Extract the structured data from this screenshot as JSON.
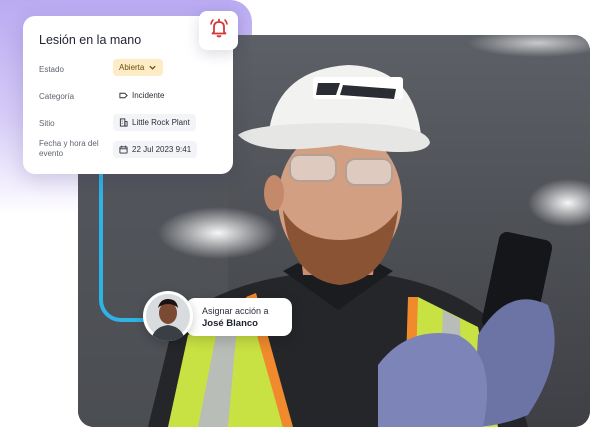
{
  "incident": {
    "title": "Lesión en la mano",
    "rows": {
      "status": {
        "label": "Estado",
        "value": "Abierta"
      },
      "category": {
        "label": "Categoría",
        "value": "Incidente"
      },
      "site": {
        "label": "Sitio",
        "value": "Little Rock Plant"
      },
      "datetime": {
        "label": "Fecha y hora del evento",
        "value": "22 Jul 2023 9:41"
      }
    }
  },
  "assignment": {
    "prompt": "Asignar acción a",
    "assignee": "José Blanco"
  },
  "icons": {
    "alert": "bell-alert-icon",
    "status_dropdown": "chevron-down-icon",
    "category": "tag-icon",
    "site": "building-icon",
    "date": "calendar-icon"
  },
  "colors": {
    "brand_purple": "#b9aaf2",
    "alert_red": "#d43a3a",
    "connector_blue": "#2fb3e6",
    "status_open_bg": "#fdecc6"
  }
}
